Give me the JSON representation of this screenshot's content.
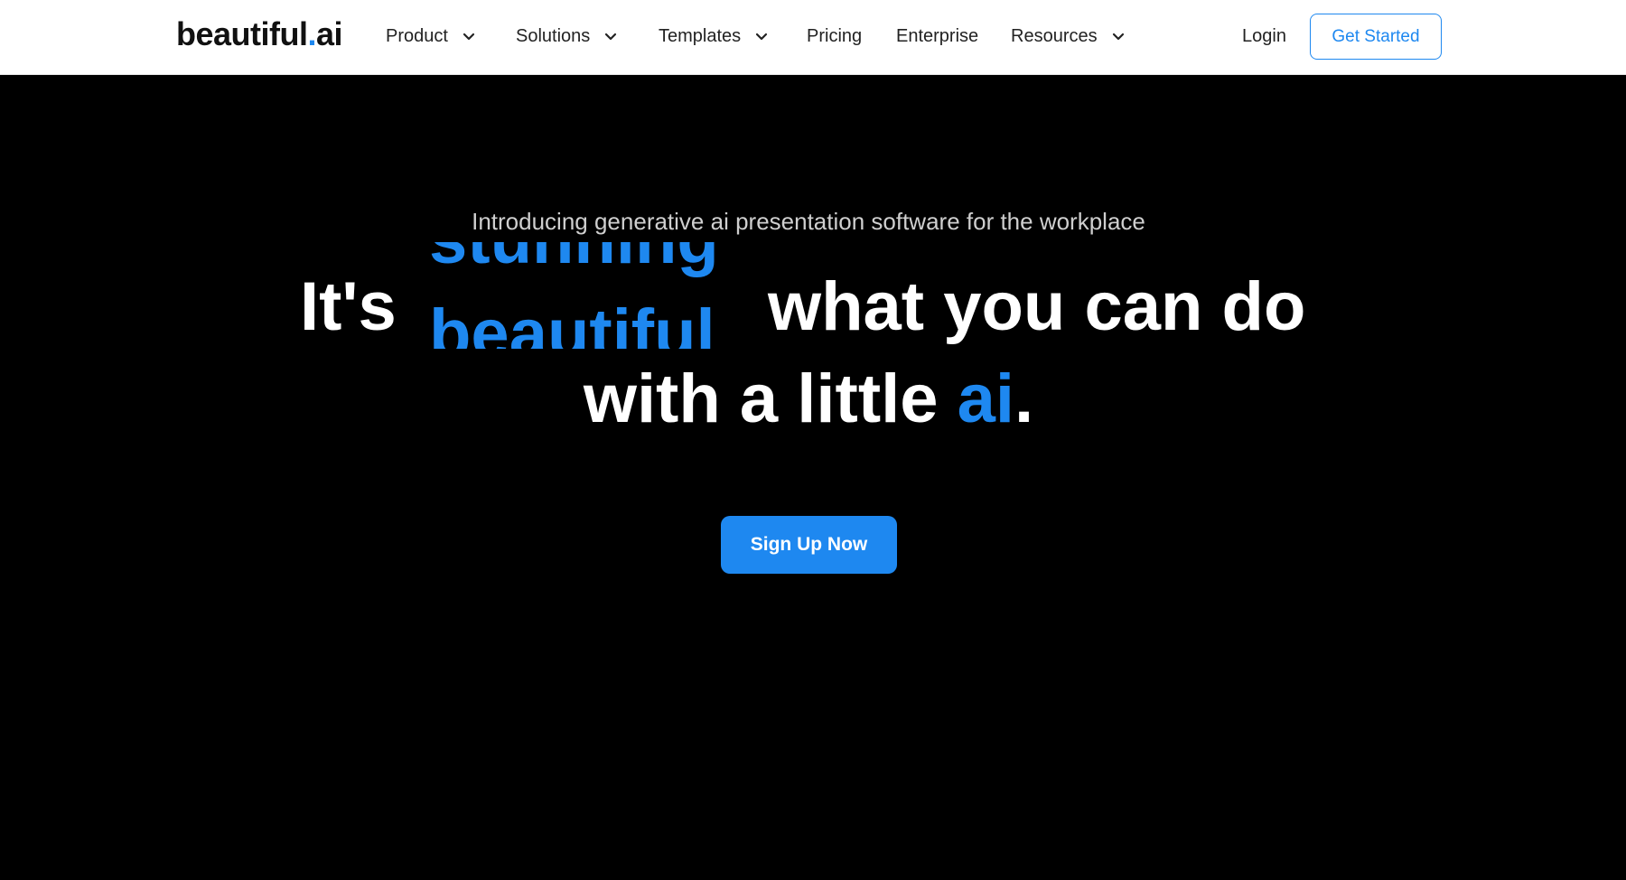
{
  "brand": {
    "logo_main": "beautiful",
    "logo_dot": ".",
    "logo_suffix": "ai",
    "accent_color": "#1e88f0"
  },
  "nav": {
    "items": [
      {
        "label": "Product",
        "has_dropdown": true
      },
      {
        "label": "Solutions",
        "has_dropdown": true
      },
      {
        "label": "Templates",
        "has_dropdown": true
      },
      {
        "label": "Pricing",
        "has_dropdown": false
      },
      {
        "label": "Enterprise",
        "has_dropdown": false
      },
      {
        "label": "Resources",
        "has_dropdown": true
      }
    ],
    "login_label": "Login",
    "cta_label": "Get Started",
    "dropdown_icon": "chevron-down-icon"
  },
  "hero": {
    "intro": "Introducing generative ai presentation software for the workplace",
    "headline_start": "It's",
    "rotating_prev": "stunning",
    "rotating_current": "beautiful",
    "headline_rest": "what you can do",
    "headline_line2_start": "with a little ",
    "headline_line2_ai": "ai",
    "headline_line2_end": ".",
    "cta_label": "Sign Up Now"
  }
}
